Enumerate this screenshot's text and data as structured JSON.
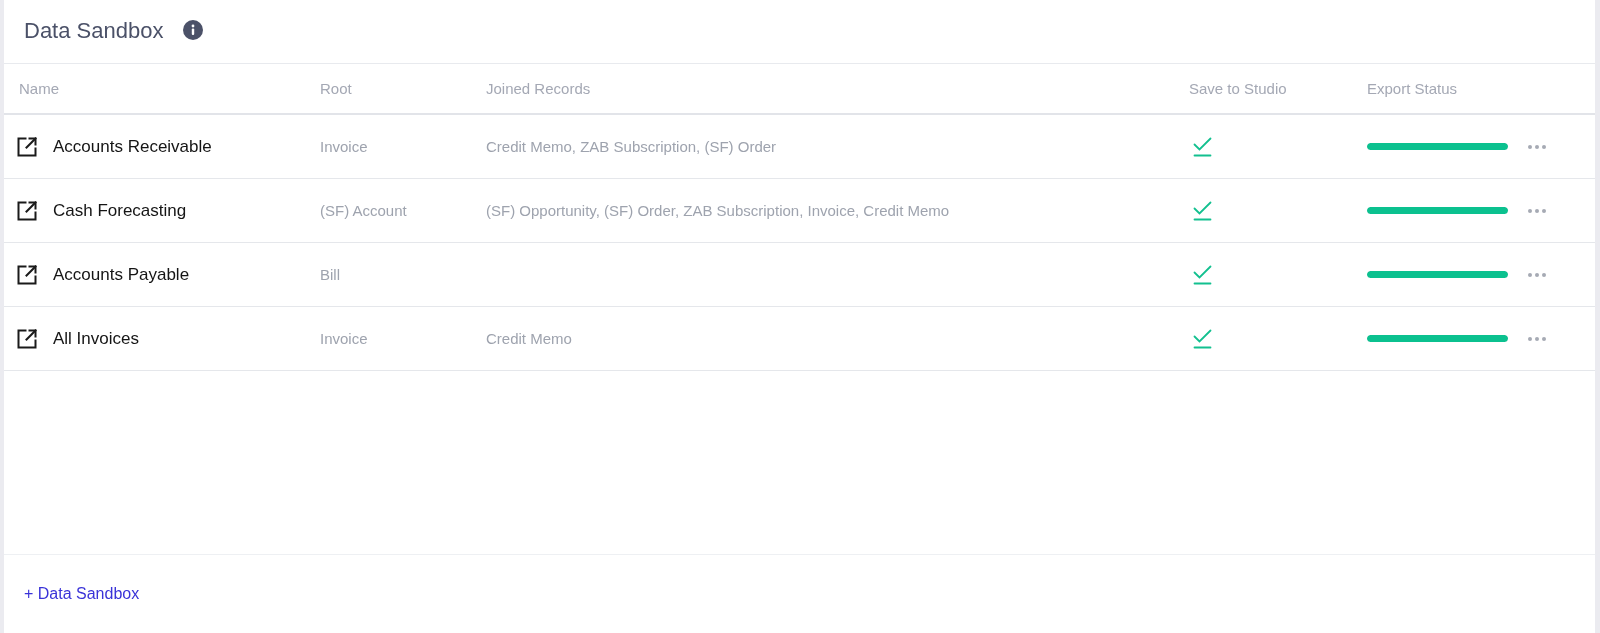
{
  "header": {
    "title": "Data Sandbox"
  },
  "table": {
    "columns": [
      "Name",
      "Root",
      "Joined Records",
      "Save to Studio",
      "Export Status"
    ],
    "rows": [
      {
        "name": "Accounts Receivable",
        "root": "Invoice",
        "joined_records": "Credit Memo, ZAB Subscription, (SF) Order",
        "saved": true,
        "export_status": {
          "level": 1
        }
      },
      {
        "name": "Cash Forecasting",
        "root": "(SF) Account",
        "joined_records": "(SF) Opportunity, (SF) Order, ZAB Subscription, Invoice, Credit Memo",
        "saved": true,
        "export_status": {
          "level": 1
        }
      },
      {
        "name": "Accounts Payable",
        "root": "Bill",
        "saved": true,
        "export_status": {
          "level": 1
        }
      },
      {
        "name": "All Invoices",
        "root": "Invoice",
        "joined_records": "Credit Memo",
        "saved": true,
        "export_status": {
          "level": 1
        }
      }
    ]
  },
  "footer": {
    "add_link": "+ Data Sandbox"
  }
}
